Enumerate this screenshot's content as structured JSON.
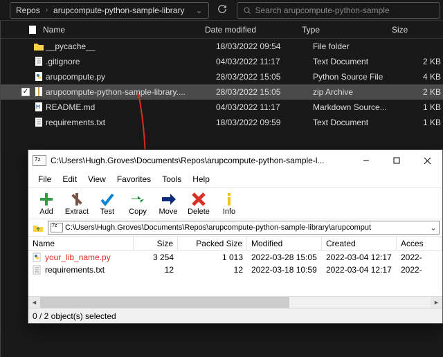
{
  "breadcrumb": {
    "level1": "Repos",
    "level2": "arupcompute-python-sample-library"
  },
  "search": {
    "placeholder": "Search arupcompute-python-sample"
  },
  "explorer_headers": {
    "name": "Name",
    "date": "Date modified",
    "type": "Type",
    "size": "Size"
  },
  "files": [
    {
      "name": "__pycache__",
      "date": "18/03/2022 09:54",
      "type": "File folder",
      "size": ""
    },
    {
      "name": ".gitignore",
      "date": "04/03/2022 11:17",
      "type": "Text Document",
      "size": "2 KB"
    },
    {
      "name": "arupcompute.py",
      "date": "28/03/2022 15:05",
      "type": "Python Source File",
      "size": "4 KB"
    },
    {
      "name": "arupcompute-python-sample-library....",
      "date": "28/03/2022 15:05",
      "type": "zip Archive",
      "size": "2 KB"
    },
    {
      "name": "README.md",
      "date": "04/03/2022 11:17",
      "type": "Markdown Source...",
      "size": "1 KB"
    },
    {
      "name": "requirements.txt",
      "date": "18/03/2022 09:59",
      "type": "Text Document",
      "size": "1 KB"
    }
  ],
  "zip": {
    "title": "C:\\Users\\Hugh.Groves\\Documents\\Repos\\arupcompute-python-sample-l...",
    "menu": {
      "file": "File",
      "edit": "Edit",
      "view": "View",
      "favorites": "Favorites",
      "tools": "Tools",
      "help": "Help"
    },
    "tools": {
      "add": "Add",
      "extract": "Extract",
      "test": "Test",
      "copy": "Copy",
      "move": "Move",
      "delete": "Delete",
      "info": "Info"
    },
    "address": "C:\\Users\\Hugh.Groves\\Documents\\Repos\\arupcompute-python-sample-library\\arupcomput",
    "headers": {
      "name": "Name",
      "size": "Size",
      "psize": "Packed Size",
      "mod": "Modified",
      "cre": "Created",
      "acc": "Acces"
    },
    "rows": [
      {
        "name": "your_lib_name.py",
        "size": "3 254",
        "psize": "1 013",
        "mod": "2022-03-28 15:05",
        "cre": "2022-03-04 12:17",
        "acc": "2022-"
      },
      {
        "name": "requirements.txt",
        "size": "12",
        "psize": "12",
        "mod": "2022-03-18 10:59",
        "cre": "2022-03-04 12:17",
        "acc": "2022-"
      }
    ],
    "status": "0 / 2 object(s) selected"
  }
}
